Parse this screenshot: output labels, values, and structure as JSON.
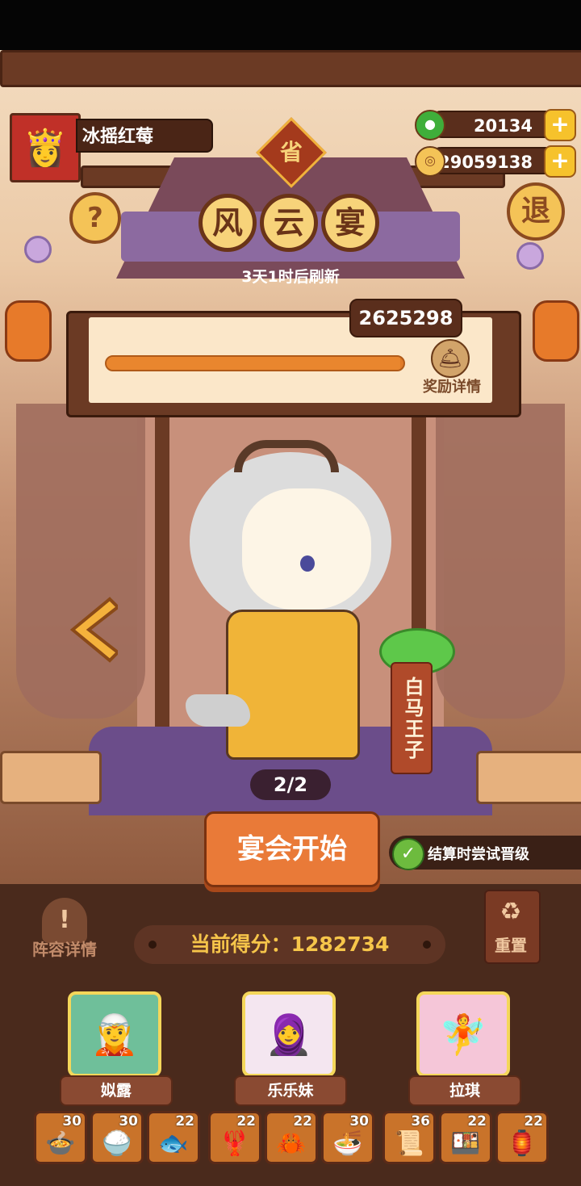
{
  "player": {
    "name": "冰摇红莓",
    "avatar_icon": "player-avatar"
  },
  "resources": {
    "gems": "20134",
    "coins": "29059138",
    "plus": "+"
  },
  "header": {
    "province_badge": "省",
    "title_chars": [
      "风",
      "云",
      "宴"
    ],
    "refresh_text": "3天1时后刷新",
    "help": "?",
    "exit": "退"
  },
  "progress": {
    "points": "2625298",
    "fill_fraction": 0.99,
    "reward_label": "奖励详情",
    "reward_icon": "🛎"
  },
  "character": {
    "name_sign": "白马王子",
    "page_counter": "2/2"
  },
  "actions": {
    "start_label": "宴会开始",
    "toggle_label": "结算时尝试晋级",
    "toggle_checked": true,
    "lineup_label": "阵容详情",
    "lineup_icon": "!",
    "reset_label": "重置",
    "reset_icon": "♻"
  },
  "score": {
    "label": "当前得分：1282734"
  },
  "heroes": [
    {
      "name": "姒露",
      "icon": "🧝",
      "bg": "#6fbf9a"
    },
    {
      "name": "乐乐妹",
      "icon": "🧕",
      "bg": "#f4e6f0"
    },
    {
      "name": "拉琪",
      "icon": "🧚",
      "bg": "#f5c6d8"
    }
  ],
  "dishes": [
    {
      "level": "30",
      "icon": "🍲"
    },
    {
      "level": "30",
      "icon": "🍚"
    },
    {
      "level": "22",
      "icon": "🐟"
    },
    {
      "level": "22",
      "icon": "🦞"
    },
    {
      "level": "22",
      "icon": "🦀"
    },
    {
      "level": "30",
      "icon": "🍜"
    },
    {
      "level": "36",
      "icon": "📜"
    },
    {
      "level": "22",
      "icon": "🍱"
    },
    {
      "level": "22",
      "icon": "🏮"
    }
  ],
  "colors": {
    "accent": "#e97a38",
    "gold": "#f6c54a",
    "stage": "#6b4d8a"
  }
}
